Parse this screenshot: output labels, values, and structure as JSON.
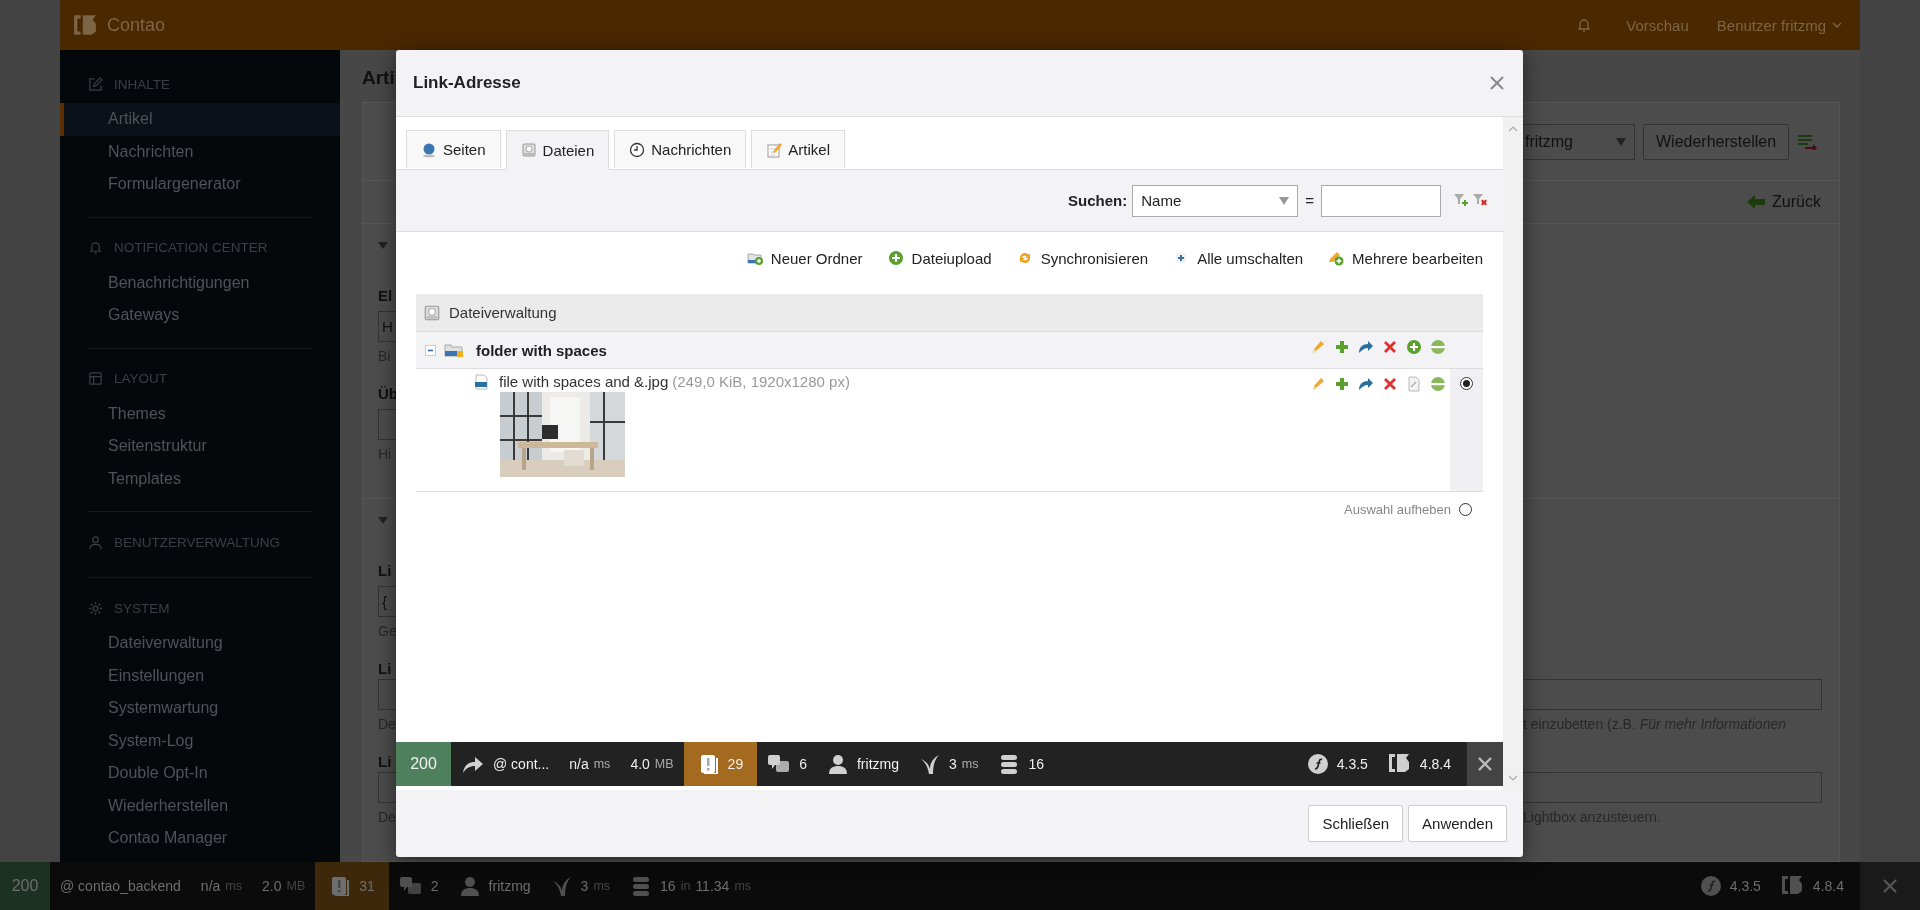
{
  "header": {
    "logo": "Contao",
    "preview": "Vorschau",
    "user_menu": "Benutzer fritzmg"
  },
  "sidebar": {
    "groups": [
      {
        "kind": "content",
        "title": "INHALTE",
        "items": [
          {
            "label": "Artikel",
            "selected": true
          },
          {
            "label": "Nachrichten",
            "selected": false
          },
          {
            "label": "Formulargenerator",
            "selected": false
          }
        ]
      },
      {
        "kind": "notification",
        "title": "NOTIFICATION CENTER",
        "items": [
          {
            "label": "Benachrichtigungen",
            "selected": false
          },
          {
            "label": "Gateways",
            "selected": false
          }
        ]
      },
      {
        "kind": "layout",
        "title": "LAYOUT",
        "items": [
          {
            "label": "Themes",
            "selected": false
          },
          {
            "label": "Seitenstruktur",
            "selected": false
          },
          {
            "label": "Templates",
            "selected": false
          }
        ]
      },
      {
        "kind": "users",
        "title": "BENUTZERVERWALTUNG"
      },
      {
        "kind": "system",
        "title": "SYSTEM",
        "items": [
          {
            "label": "Dateiverwaltung",
            "selected": false
          },
          {
            "label": "Einstellungen",
            "selected": false
          },
          {
            "label": "Systemwartung",
            "selected": false
          },
          {
            "label": "System-Log",
            "selected": false
          },
          {
            "label": "Double Opt-In",
            "selected": false
          },
          {
            "label": "Wiederherstellen",
            "selected": false
          },
          {
            "label": "Contao Manager",
            "selected": false
          }
        ]
      }
    ]
  },
  "background": {
    "heading": "Arti",
    "user_filter": "fritzmg",
    "restore_button": "Wiederherstellen",
    "back_link": "Zurück",
    "sections": [
      {
        "rows": [
          {
            "kind": "label",
            "left": "El"
          },
          {
            "kind": "input",
            "left": "H"
          },
          {
            "kind": "help",
            "left": "Bi"
          },
          {
            "kind": "label",
            "left": "Üb"
          },
          {
            "kind": "input"
          },
          {
            "kind": "help",
            "left": "Hi"
          }
        ]
      },
      {
        "rows": [
          {
            "kind": "label",
            "left": "Li"
          },
          {
            "kind": "input",
            "left": "{"
          },
          {
            "kind": "help",
            "left": "Ge"
          },
          {
            "kind": "label",
            "left": "Li"
          },
          {
            "kind": "wide_input"
          },
          {
            "kind": "help",
            "left": "De",
            "right": "t einzubetten (z.B. *Für mehr Informationen*"
          },
          {
            "kind": "label",
            "left": "Li"
          },
          {
            "kind": "wide_input"
          },
          {
            "kind": "help",
            "left": "De",
            "right": "Lightbox anzusteuern."
          }
        ]
      }
    ]
  },
  "page_toolbar": [
    {
      "kind": "status",
      "value": "200"
    },
    {
      "kind": "route",
      "value": "@ contao_backend"
    },
    {
      "kind": "time",
      "value": "n/a",
      "unit": "ms"
    },
    {
      "kind": "memory",
      "value": "2.0",
      "unit": "MB"
    },
    {
      "kind": "logs",
      "value": "31"
    },
    {
      "kind": "translation",
      "value": "2"
    },
    {
      "kind": "user",
      "value": "fritzmg"
    },
    {
      "kind": "security",
      "value": "3",
      "unit": "ms"
    },
    {
      "kind": "db",
      "value": "16",
      "unit": "in",
      "value2": "11.34",
      "unit2": "ms"
    },
    {
      "kind": "symfony",
      "value": "4.3.5"
    },
    {
      "kind": "contao",
      "value": "4.8.4"
    },
    {
      "kind": "close"
    }
  ],
  "dialog": {
    "title": "Link-Adresse",
    "tabs": [
      {
        "kind": "pages",
        "label": "Seiten",
        "selected": false
      },
      {
        "kind": "files",
        "label": "Dateien",
        "selected": true
      },
      {
        "kind": "news",
        "label": "Nachrichten",
        "selected": false
      },
      {
        "kind": "articles",
        "label": "Artikel",
        "selected": false
      }
    ],
    "search": {
      "label": "Suchen:",
      "field": "Name",
      "operator": "="
    },
    "actions": [
      {
        "kind": "new_folder",
        "label": "Neuer Ordner"
      },
      {
        "kind": "upload",
        "label": "Dateiupload"
      },
      {
        "kind": "sync",
        "label": "Synchronisieren"
      },
      {
        "kind": "toggle_all",
        "label": "Alle umschalten"
      },
      {
        "kind": "edit_multiple",
        "label": "Mehrere bearbeiten"
      }
    ],
    "tree": {
      "title": "Dateiverwaltung",
      "nodes": [
        {
          "kind": "folder",
          "label": "folder with spaces",
          "expanded": true,
          "actions": [
            {
              "kind": "edit"
            },
            {
              "kind": "copy"
            },
            {
              "kind": "move"
            },
            {
              "kind": "delete"
            },
            {
              "kind": "upload"
            },
            {
              "kind": "toggle"
            }
          ],
          "children": [
            {
              "kind": "file",
              "label": "file with spaces and &.jpg",
              "meta": "(249,0 KiB, 1920x1280 px)",
              "preview": {
                "kind": "picture"
              },
              "selected": true,
              "actions": [
                {
                  "kind": "edit"
                },
                {
                  "kind": "copy"
                },
                {
                  "kind": "move"
                },
                {
                  "kind": "delete"
                },
                {
                  "kind": "source"
                },
                {
                  "kind": "toggle"
                }
              ]
            }
          ]
        }
      ]
    },
    "clear_selection": {
      "label": "Auswahl aufheben",
      "selected": false
    },
    "toolbar": [
      {
        "kind": "status",
        "value": "200"
      },
      {
        "kind": "redirect",
        "value": "@ cont..."
      },
      {
        "kind": "time",
        "value": "n/a",
        "unit": "ms"
      },
      {
        "kind": "memory",
        "value": "4.0",
        "unit": "MB"
      },
      {
        "kind": "logs",
        "value": "29"
      },
      {
        "kind": "translation",
        "value": "6"
      },
      {
        "kind": "user",
        "value": "fritzmg"
      },
      {
        "kind": "security",
        "value": "3",
        "unit": "ms"
      },
      {
        "kind": "db",
        "value": "16"
      },
      {
        "kind": "symfony",
        "value": "4.3.5"
      },
      {
        "kind": "contao",
        "value": "4.8.4"
      },
      {
        "kind": "close"
      }
    ],
    "buttons": [
      {
        "label": "Schließen"
      },
      {
        "label": "Anwenden"
      }
    ]
  }
}
